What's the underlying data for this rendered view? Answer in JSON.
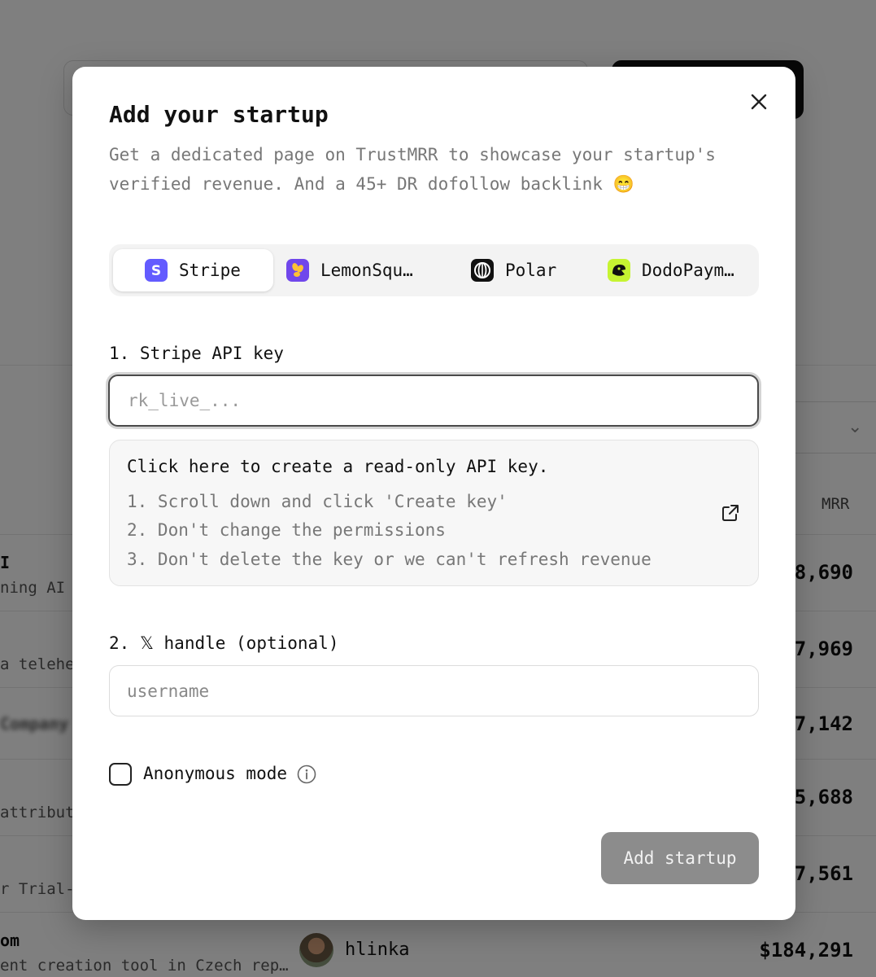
{
  "modal": {
    "title": "Add your startup",
    "subtitle": "Get a dedicated page on TrustMRR to showcase your startup's verified revenue. And a 45+ DR dofollow backlink 😁",
    "close_icon": "close-icon",
    "tabs": [
      {
        "label": "Stripe",
        "icon": "stripe-logo-icon",
        "active": true,
        "color": "#635bff"
      },
      {
        "label": "LemonSqu…",
        "icon": "lemonsqueezy-logo-icon",
        "active": false,
        "color": "#7047eb"
      },
      {
        "label": "Polar",
        "icon": "polar-logo-icon",
        "active": false,
        "color": "#111111"
      },
      {
        "label": "DodoPaym…",
        "icon": "dodopayments-logo-icon",
        "active": false,
        "color": "#c6f432"
      }
    ],
    "api_key": {
      "label": "1. Stripe API key",
      "placeholder": "rk_live_...",
      "value": ""
    },
    "help": {
      "title": "Click here to create a read-only API key.",
      "steps": [
        "1. Scroll down and click 'Create key'",
        "2. Don't change the permissions",
        "3. Don't delete the key or we can't refresh revenue"
      ],
      "icon": "external-link-icon"
    },
    "x_handle": {
      "label_prefix": "2.",
      "label_icon": "𝕏",
      "label_suffix": "handle (optional)",
      "placeholder": "username"
    },
    "anonymous": {
      "label": "Anonymous mode",
      "checked": false,
      "info_icon": "info-icon"
    },
    "submit_label": "Add startup"
  },
  "background": {
    "mrr_header": "MRR",
    "rows": [
      {
        "title": "I",
        "subtitle": "ning AI",
        "mrr": "8,690"
      },
      {
        "title": "",
        "subtitle": "a telehe",
        "mrr": "7,969"
      },
      {
        "title": "Company",
        "subtitle": "",
        "mrr": "7,142"
      },
      {
        "title": "",
        "subtitle": "attribut",
        "mrr": "5,688"
      },
      {
        "title": "",
        "subtitle": "r Trial-",
        "mrr": "7,561"
      },
      {
        "title": "om",
        "subtitle": "ent creation tool in Czech rep…",
        "mrr": "$184,291",
        "handle": "hlinka"
      }
    ]
  },
  "colors": {
    "overlay": "rgba(0,0,0,0.5)",
    "submit_disabled": "#8c8c8c",
    "stripe": "#635bff"
  }
}
